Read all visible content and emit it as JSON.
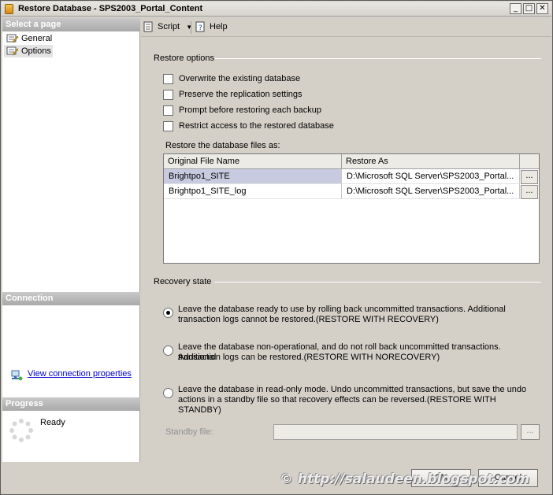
{
  "window": {
    "title": "Restore Database - SPS2003_Portal_Content",
    "minimize_glyph": "_",
    "maximize_glyph": "□",
    "close_glyph": "✕"
  },
  "left_pane": {
    "select_page_header": "Select a page",
    "pages": [
      {
        "label": "General",
        "icon": "page-icon"
      },
      {
        "label": "Options",
        "icon": "page-icon",
        "selected": true
      }
    ],
    "connection_header": "Connection",
    "view_connection_link": "View connection properties",
    "progress_header": "Progress",
    "progress_status": "Ready"
  },
  "toolbar": {
    "script_label": "Script",
    "help_label": "Help"
  },
  "restore_options": {
    "title": "Restore options",
    "checkboxes": [
      {
        "label": "Overwrite the existing database",
        "checked": false
      },
      {
        "label": "Preserve the replication settings",
        "checked": false
      },
      {
        "label": "Prompt before restoring each backup",
        "checked": false
      },
      {
        "label": "Restrict access to the restored database",
        "checked": false
      }
    ],
    "files_label": "Restore the database files as:",
    "files_table": {
      "columns": [
        "Original File Name",
        "Restore As"
      ],
      "rows": [
        {
          "original": "Brightpo1_SITE",
          "restore_as": "D:\\Microsoft SQL Server\\SPS2003_Portal...",
          "selected": true
        },
        {
          "original": "Brightpo1_SITE_log",
          "restore_as": "D:\\Microsoft SQL Server\\SPS2003_Portal...",
          "selected": false
        }
      ],
      "ellipsis": "..."
    }
  },
  "recovery_state": {
    "title": "Recovery state",
    "options": [
      {
        "line1": "Leave the database ready to use by rolling back uncommitted transactions. Additional",
        "line2": "transaction logs cannot be restored.(RESTORE WITH RECOVERY)",
        "selected": true
      },
      {
        "line1": "Leave the database non-operational, and do not roll back uncommitted transactions. Additional",
        "line2": "transaction logs can be restored.(RESTORE WITH NORECOVERY)",
        "selected": false
      },
      {
        "line1": "Leave the database in read-only mode. Undo uncommitted transactions, but save the undo",
        "line2": "actions in a standby file so that recovery effects can be reversed.(RESTORE WITH STANDBY)",
        "selected": false
      }
    ],
    "standby_label": "Standby file:",
    "standby_value": "",
    "standby_browse": "..."
  },
  "buttons": {
    "ok": "OK",
    "cancel": "Cancel"
  },
  "watermark": "© http://salaudeen.blogspot.com"
}
